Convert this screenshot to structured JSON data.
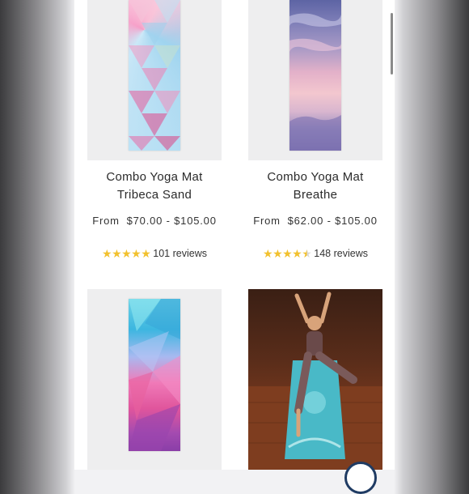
{
  "products": [
    {
      "title_line1": "Combo Yoga Mat",
      "title_line2": "Tribeca Sand",
      "price_from": "From",
      "price_range": "$70.00 - $105.00",
      "stars": "★★★★★",
      "reviews": "101 reviews"
    },
    {
      "title_line1": "Combo Yoga Mat",
      "title_line2": "Breathe",
      "price_from": "From",
      "price_range": "$62.00 - $105.00",
      "stars": "★★★★",
      "half_star": "★",
      "reviews": "148 reviews"
    }
  ],
  "icons": {
    "star": "star-icon"
  },
  "colors": {
    "star": "#f2c12e",
    "page_bg": "#ffffff",
    "thumb_bg": "#eeeeef"
  }
}
